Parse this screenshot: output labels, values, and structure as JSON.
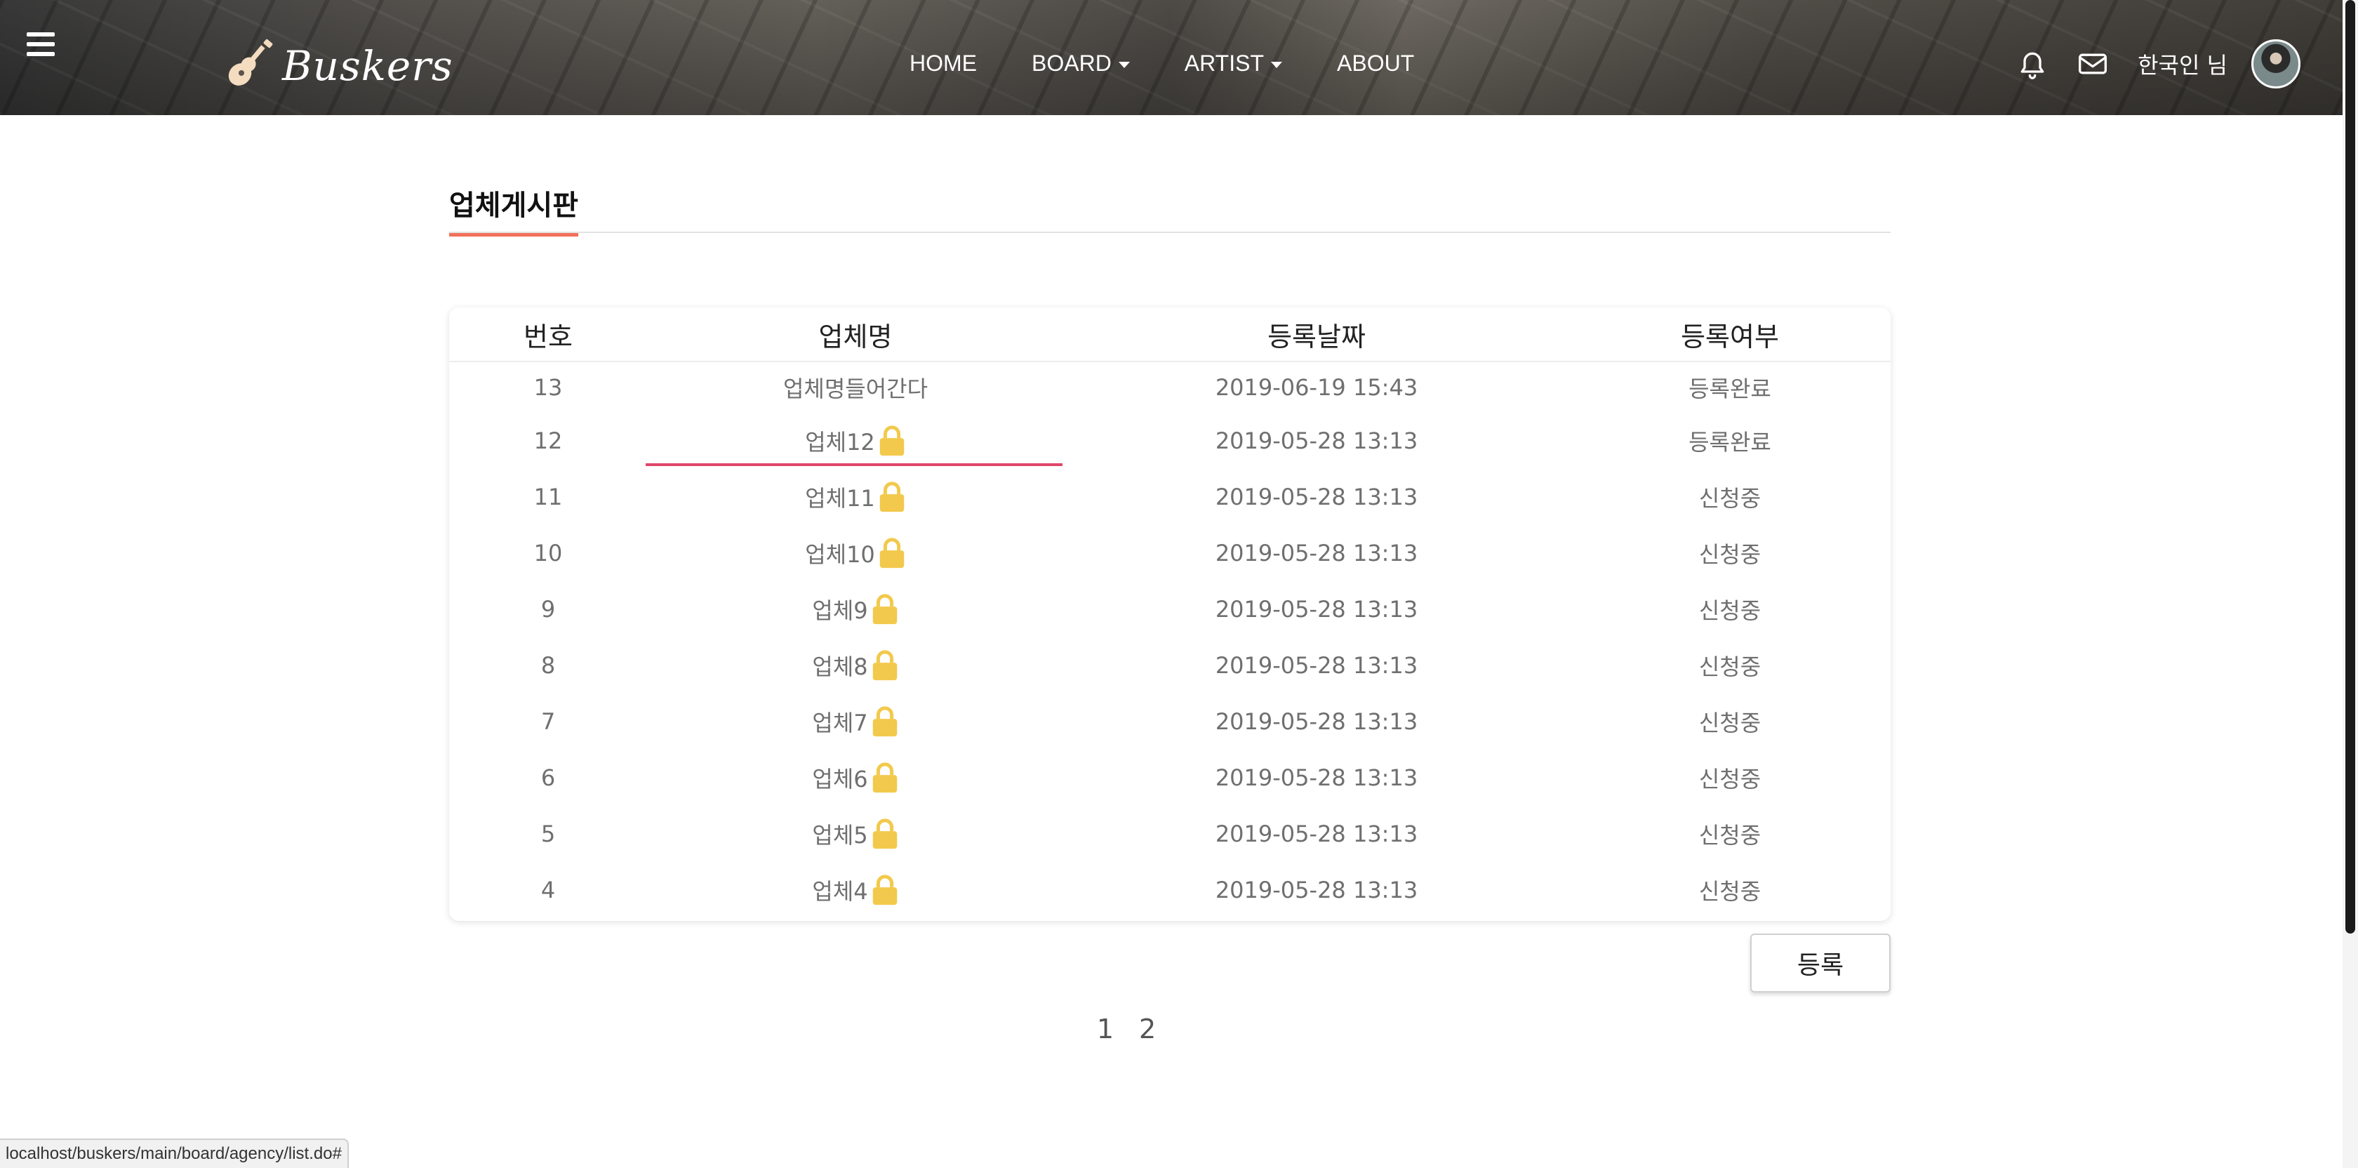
{
  "header": {
    "logo_text": "Buskers",
    "nav": [
      {
        "label": "HOME",
        "dropdown": false
      },
      {
        "label": "BOARD",
        "dropdown": true
      },
      {
        "label": "ARTIST",
        "dropdown": true
      },
      {
        "label": "ABOUT",
        "dropdown": false
      }
    ],
    "user_name": "한국인 님",
    "icons": [
      "menu-icon",
      "guitar-icon",
      "bell-icon",
      "mail-icon"
    ]
  },
  "board": {
    "title": "업체게시판",
    "columns": [
      "번호",
      "업체명",
      "등록날짜",
      "등록여부"
    ],
    "rows": [
      {
        "no": "13",
        "name": "업체명들어간다",
        "locked": false,
        "date": "2019-06-19 15:43",
        "status": "등록완료"
      },
      {
        "no": "12",
        "name": "업체12",
        "locked": true,
        "date": "2019-05-28 13:13",
        "status": "등록완료"
      },
      {
        "no": "11",
        "name": "업체11",
        "locked": true,
        "date": "2019-05-28 13:13",
        "status": "신청중"
      },
      {
        "no": "10",
        "name": "업체10",
        "locked": true,
        "date": "2019-05-28 13:13",
        "status": "신청중"
      },
      {
        "no": "9",
        "name": "업체9",
        "locked": true,
        "date": "2019-05-28 13:13",
        "status": "신청중"
      },
      {
        "no": "8",
        "name": "업체8",
        "locked": true,
        "date": "2019-05-28 13:13",
        "status": "신청중"
      },
      {
        "no": "7",
        "name": "업체7",
        "locked": true,
        "date": "2019-05-28 13:13",
        "status": "신청중"
      },
      {
        "no": "6",
        "name": "업체6",
        "locked": true,
        "date": "2019-05-28 13:13",
        "status": "신청중"
      },
      {
        "no": "5",
        "name": "업체5",
        "locked": true,
        "date": "2019-05-28 13:13",
        "status": "신청중"
      },
      {
        "no": "4",
        "name": "업체4",
        "locked": true,
        "date": "2019-05-28 13:13",
        "status": "신청중"
      }
    ],
    "register_button": "등록",
    "pages": [
      "1",
      "2"
    ]
  },
  "status_bar": {
    "url": "localhost/buskers/main/board/agency/list.do#"
  },
  "colors": {
    "accent_underline": "#f2705a",
    "hover_line": "#e0486a",
    "lock": "#f2c94c"
  }
}
